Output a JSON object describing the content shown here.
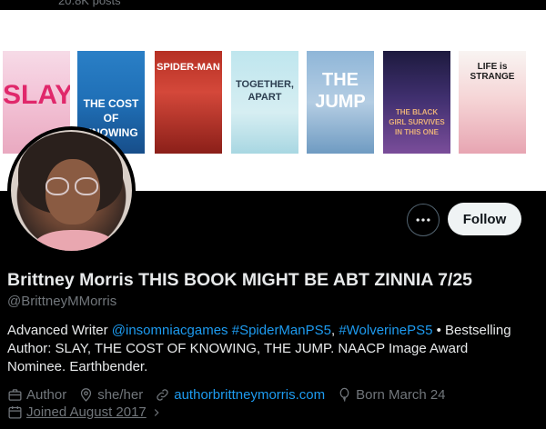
{
  "header": {
    "posts_count": "20.8K posts"
  },
  "banner": {
    "covers": [
      {
        "title": "SLAY",
        "color": "#e0286b"
      },
      {
        "title": "THE COST OF KNOWING",
        "color": "#ffffff"
      },
      {
        "title": "SPIDER-MAN",
        "color": "#ffffff"
      },
      {
        "title": "TOGETHER, APART",
        "color": "#2c3e50"
      },
      {
        "title": "THE JUMP",
        "color": "#ffffff"
      },
      {
        "title": "THE BLACK GIRL SURVIVES IN THIS ONE",
        "color": "#e8b07a"
      },
      {
        "title": "LIFE is STRANGE",
        "color": "#1c1c1c"
      }
    ]
  },
  "actions": {
    "more_icon": "more-horizontal-icon",
    "follow_label": "Follow"
  },
  "profile": {
    "display_name": "Brittney Morris THIS BOOK MIGHT BE ABT ZINNIA 7/25",
    "handle": "@BrittneyMMorris",
    "bio": {
      "text_1": "Advanced Writer ",
      "link_1": "@insomniacgames",
      "sep_1": " ",
      "link_2": "#SpiderManPS5",
      "sep_2": ", ",
      "link_3": "#WolverinePS5",
      "text_2": " • Bestselling Author: SLAY, THE COST OF KNOWING, THE JUMP. NAACP Image Award Nominee. Earthbender."
    },
    "meta": {
      "category": "Author",
      "pronouns": "she/her",
      "website": "authorbrittneymorris.com",
      "born": "Born March 24",
      "joined": "Joined August 2017"
    }
  },
  "colors": {
    "accent": "#1d9bf0",
    "muted": "#71767b",
    "text": "#e7e9ea",
    "background": "#000000"
  }
}
